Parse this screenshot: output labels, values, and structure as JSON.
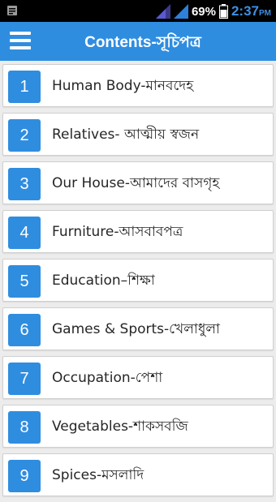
{
  "status_bar": {
    "battery_percent": "69%",
    "time": "2:37",
    "ampm": "PM",
    "icons": [
      "notification-icon",
      "signal-icon",
      "signal-icon",
      "battery-icon"
    ],
    "time_color": "#3d8fe3"
  },
  "app_bar": {
    "title": "Contents-সূচিপত্র",
    "menu_icon": "hamburger-menu-icon",
    "color": "#2f8de0"
  },
  "items": [
    {
      "number": "1",
      "label": "Human Body-মানবদেহ"
    },
    {
      "number": "2",
      "label": "Relatives- আত্মীয় স্বজন"
    },
    {
      "number": "3",
      "label": "Our House-আমাদের বাসগৃহ"
    },
    {
      "number": "4",
      "label": "Furniture-আসবাবপত্র"
    },
    {
      "number": "5",
      "label": "Education–শিক্ষা"
    },
    {
      "number": "6",
      "label": "Games & Sports-খেলাধুলা"
    },
    {
      "number": "7",
      "label": "Occupation-পেশা"
    },
    {
      "number": "8",
      "label": "Vegetables-শাকসবজি"
    },
    {
      "number": "9",
      "label": "Spices-মসলাদি"
    }
  ]
}
